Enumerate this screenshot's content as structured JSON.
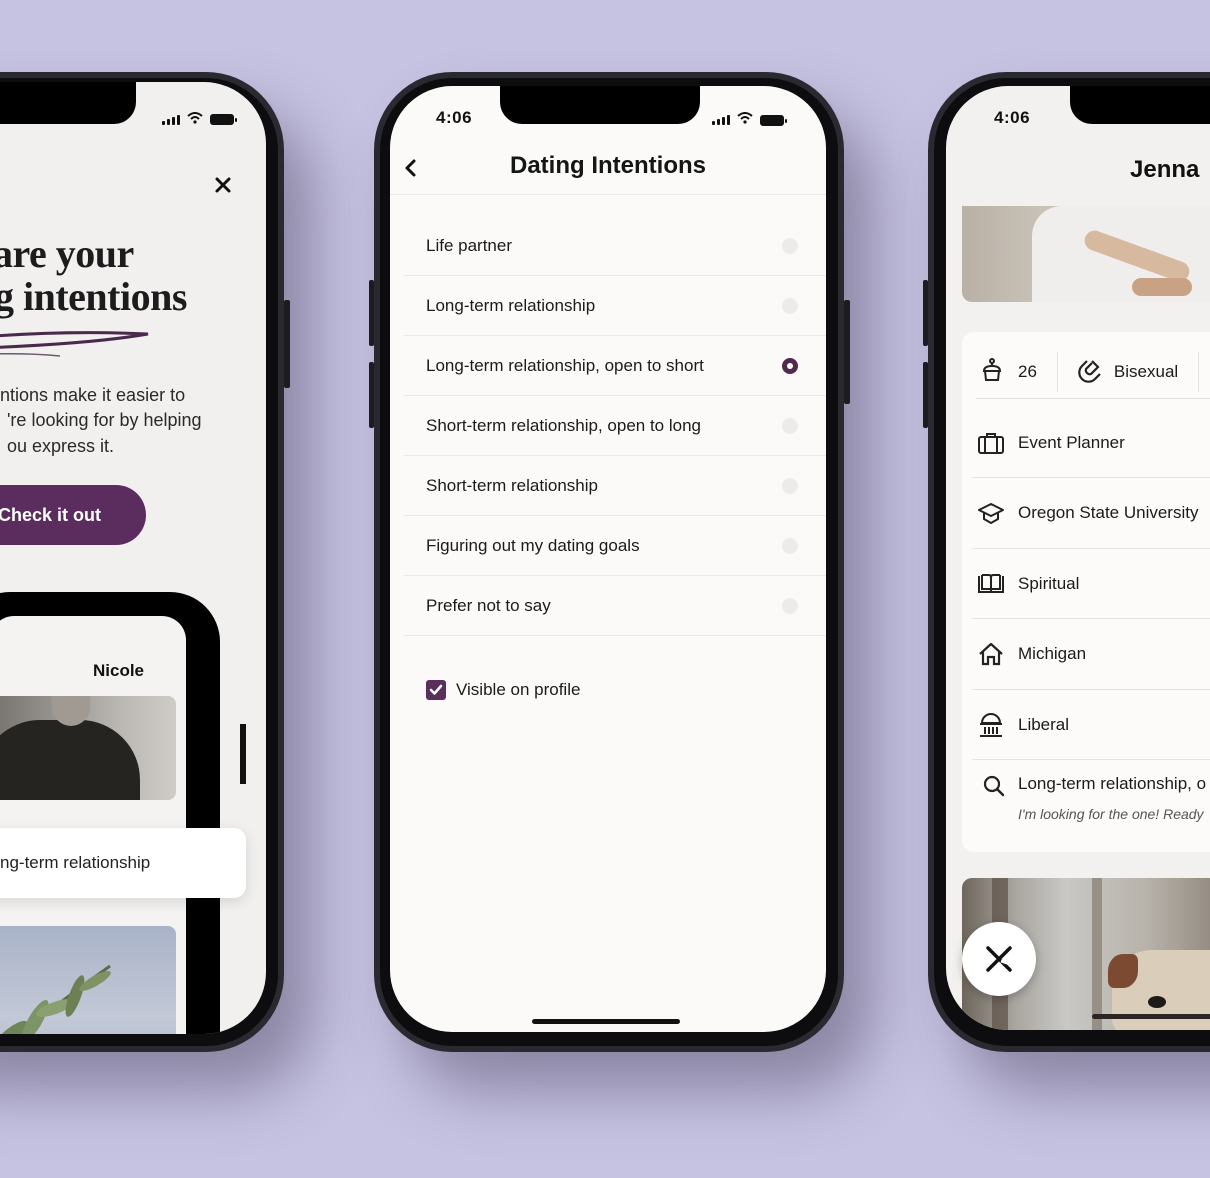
{
  "theme": {
    "background": "#c6c3e2",
    "accent": "#5a2d5e",
    "radio_selected": "#50294f"
  },
  "left_phone": {
    "close_icon": "close-icon",
    "headline_lines": [
      "are your",
      "g intentions"
    ],
    "body_lines": [
      "ntions make it easier to",
      "'re looking for by helping",
      "ou express it."
    ],
    "cta_label": "Check it out",
    "preview": {
      "name": "Nicole",
      "more_icon": "...",
      "toast_text": "ng-term relationship"
    }
  },
  "center_phone": {
    "status_time": "4:06",
    "title": "Dating Intentions",
    "back_icon": "‹",
    "options": [
      {
        "label": "Life partner",
        "selected": false
      },
      {
        "label": "Long-term relationship",
        "selected": false
      },
      {
        "label": "Long-term relationship, open to short",
        "selected": true
      },
      {
        "label": "Short-term relationship, open to long",
        "selected": false
      },
      {
        "label": "Short-term relationship",
        "selected": false
      },
      {
        "label": "Figuring out my dating goals",
        "selected": false
      },
      {
        "label": "Prefer not to say",
        "selected": false
      }
    ],
    "visible_on_profile": {
      "label": "Visible on profile",
      "checked": true
    }
  },
  "right_phone": {
    "status_time": "4:06",
    "name": "Jenna",
    "vitals": {
      "age": "26",
      "sexuality": "Bisexual"
    },
    "rows": [
      {
        "icon": "briefcase-icon",
        "text": "Event Planner"
      },
      {
        "icon": "graduation-cap-icon",
        "text": "Oregon State University"
      },
      {
        "icon": "book-icon",
        "text": "Spiritual"
      },
      {
        "icon": "home-icon",
        "text": "Michigan"
      },
      {
        "icon": "capitol-icon",
        "text": "Liberal"
      }
    ],
    "intention": {
      "text": "Long-term relationship, o",
      "note": "I'm looking for the one! Ready"
    },
    "skip_icon": "skip-x-icon"
  }
}
